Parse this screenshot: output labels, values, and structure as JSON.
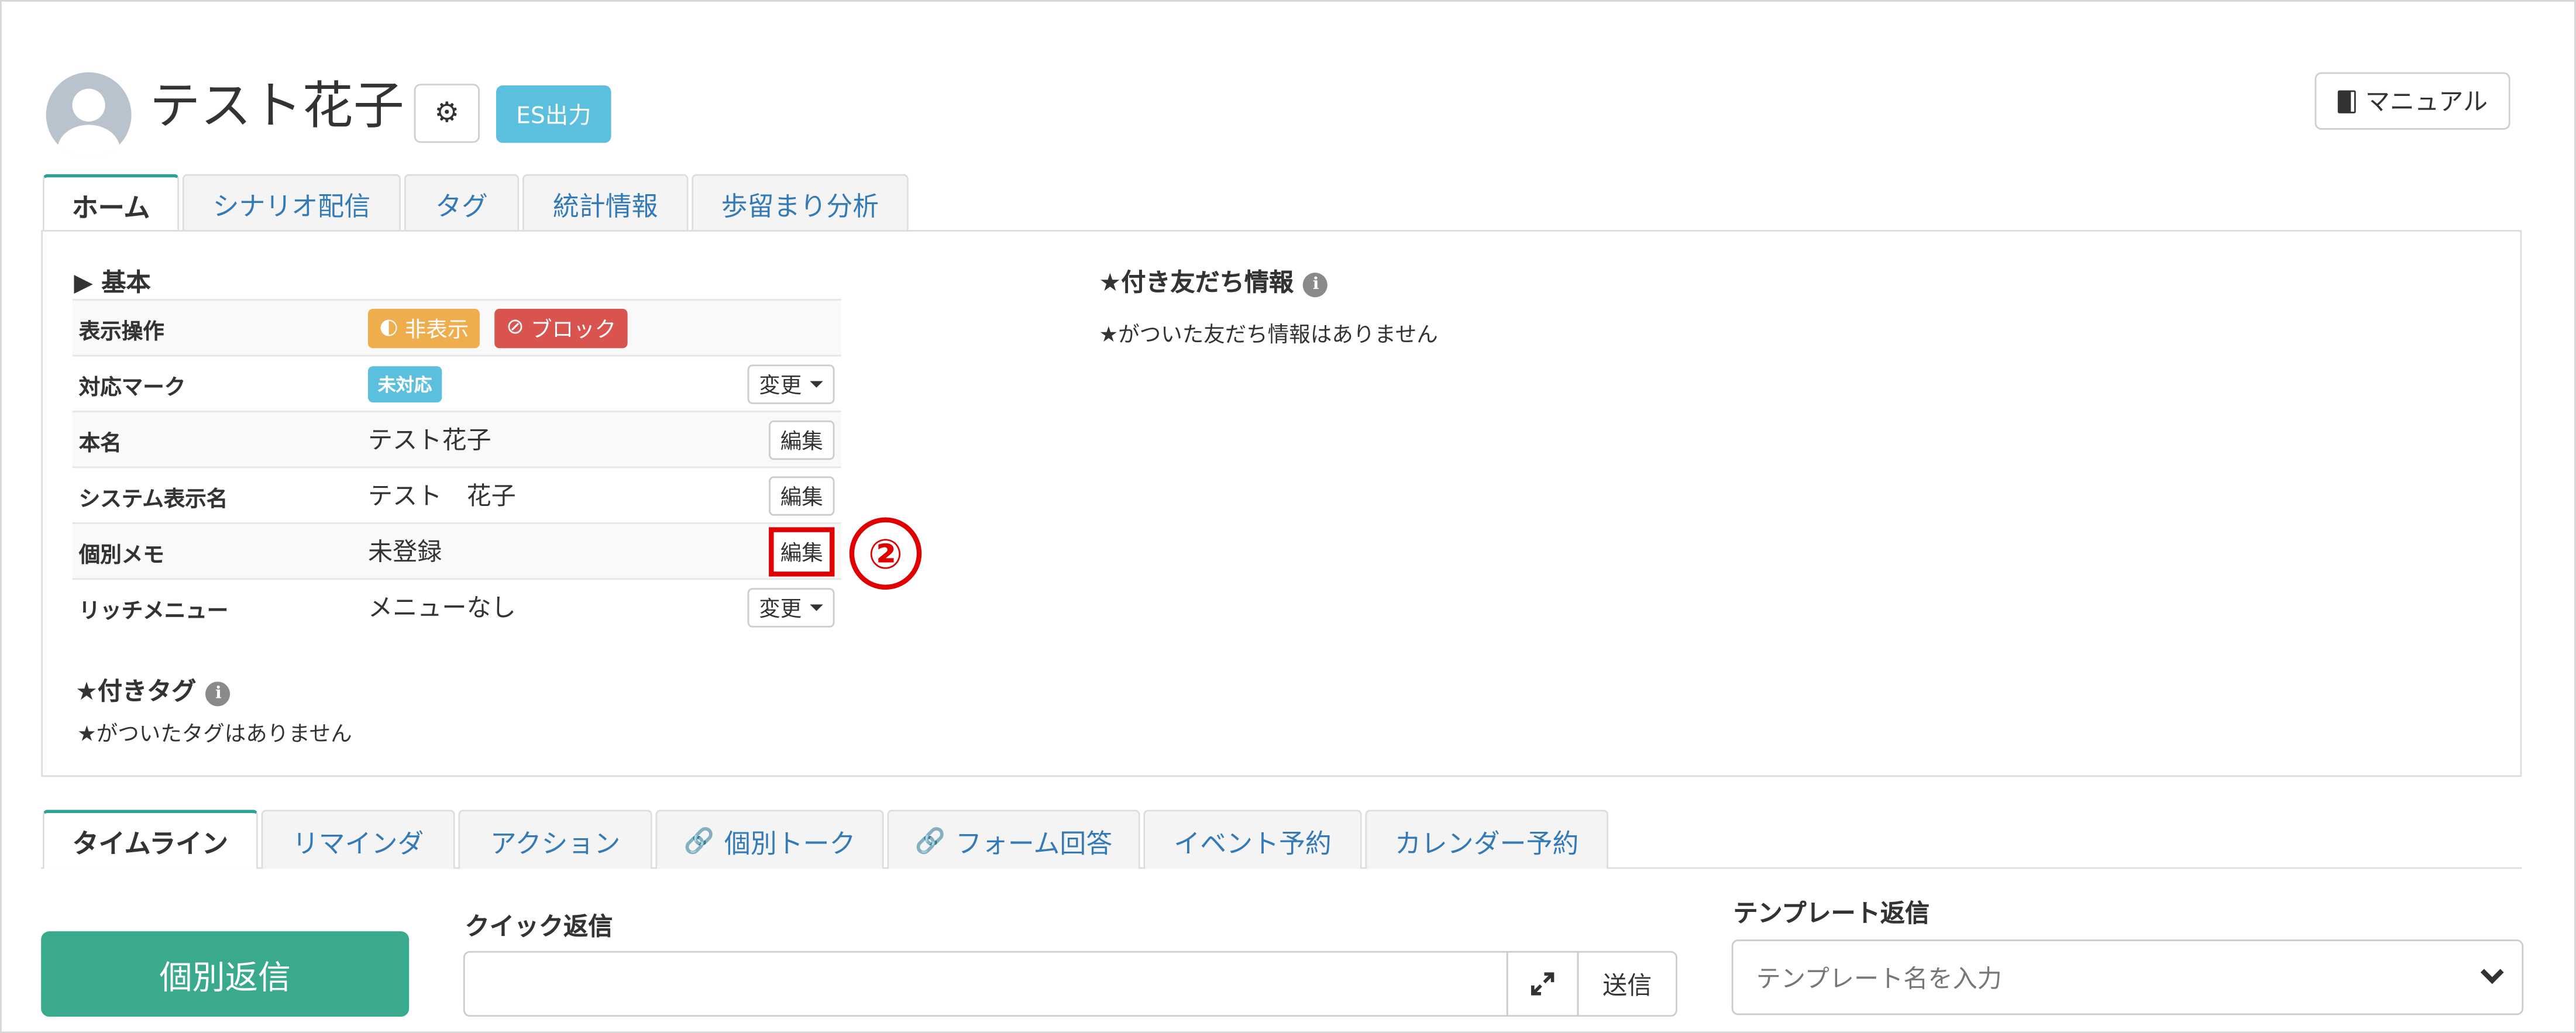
{
  "header": {
    "user_name": "テスト花子",
    "gear_icon": "gear-icon",
    "es_button": "ES出力",
    "manual_button": "マニュアル"
  },
  "top_tabs": [
    {
      "label": "ホーム",
      "active": true
    },
    {
      "label": "シナリオ配信",
      "active": false
    },
    {
      "label": "タグ",
      "active": false
    },
    {
      "label": "統計情報",
      "active": false
    },
    {
      "label": "歩留まり分析",
      "active": false
    }
  ],
  "basic": {
    "title": "▶ 基本",
    "rows": {
      "display_ops": {
        "label": "表示操作",
        "hide_button": "非表示",
        "block_button": "ブロック"
      },
      "response_mark": {
        "label": "対応マーク",
        "status": "未対応",
        "action": "変更"
      },
      "real_name": {
        "label": "本名",
        "value": "テスト花子",
        "action": "編集"
      },
      "system_name": {
        "label": "システム表示名",
        "value": "テスト　花子",
        "action": "編集"
      },
      "memo": {
        "label": "個別メモ",
        "value": "未登録",
        "action": "編集"
      },
      "rich_menu": {
        "label": "リッチメニュー",
        "value": "メニューなし",
        "action": "変更"
      }
    }
  },
  "annotation": {
    "number": "②",
    "color": "#e00000"
  },
  "starred_tags": {
    "title": "★付きタグ",
    "empty": "★がついたタグはありません"
  },
  "starred_friend_info": {
    "title": "★付き友だち情報",
    "empty": "★がついた友だち情報はありません"
  },
  "bottom_tabs": [
    {
      "label": "タイムライン",
      "active": true,
      "link_icon": false
    },
    {
      "label": "リマインダ",
      "active": false,
      "link_icon": false
    },
    {
      "label": "アクション",
      "active": false,
      "link_icon": false
    },
    {
      "label": "個別トーク",
      "active": false,
      "link_icon": true
    },
    {
      "label": "フォーム回答",
      "active": false,
      "link_icon": true
    },
    {
      "label": "イベント予約",
      "active": false,
      "link_icon": false
    },
    {
      "label": "カレンダー予約",
      "active": false,
      "link_icon": false
    }
  ],
  "reply": {
    "individual_reply_button": "個別返信",
    "quick_reply_label": "クイック返信",
    "quick_reply_value": "",
    "send_button": "送信",
    "template_label": "テンプレート返信",
    "template_placeholder": "テンプレート名を入力"
  },
  "colors": {
    "accent_teal": "#3aaa8f",
    "info_blue": "#5bc0de",
    "warning_orange": "#f0ad4e",
    "danger_red": "#d9534f",
    "link_blue": "#337ab7",
    "highlight_red": "#e00000"
  }
}
